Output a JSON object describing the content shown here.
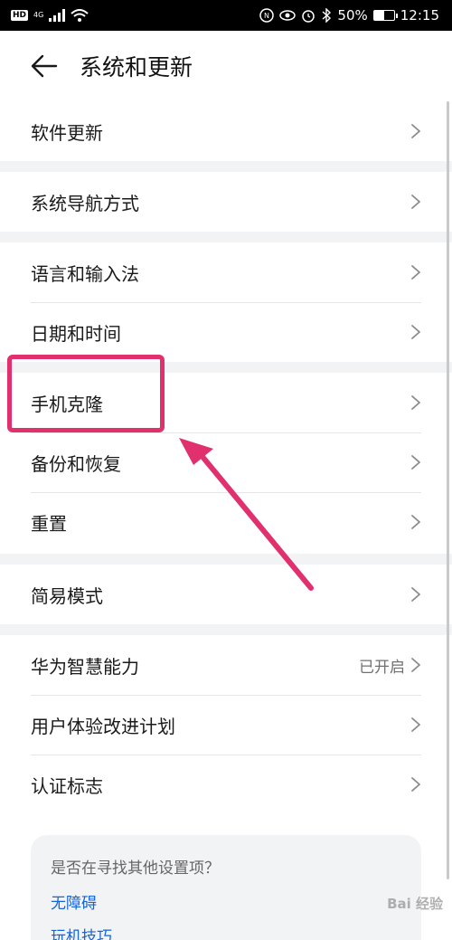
{
  "status_bar": {
    "hd": "HD",
    "network": "4G",
    "battery": "50%",
    "battery_level": 0.5,
    "time": "12:15",
    "icons": [
      "signal-icon",
      "wifi-icon",
      "nfc-icon",
      "eye-icon",
      "alarm-icon",
      "bluetooth-icon",
      "battery-icon"
    ]
  },
  "header": {
    "title": "系统和更新",
    "back_icon": "arrow-left-icon"
  },
  "groups": [
    {
      "items": [
        {
          "label": "软件更新"
        }
      ]
    },
    {
      "items": [
        {
          "label": "系统导航方式"
        }
      ]
    },
    {
      "items": [
        {
          "label": "语言和输入法"
        },
        {
          "label": "日期和时间"
        }
      ]
    },
    {
      "items": [
        {
          "label": "手机克隆"
        },
        {
          "label": "备份和恢复"
        },
        {
          "label": "重置"
        }
      ]
    },
    {
      "items": [
        {
          "label": "简易模式"
        }
      ]
    },
    {
      "items": [
        {
          "label": "华为智慧能力",
          "value": "已开启"
        },
        {
          "label": "用户体验改进计划"
        },
        {
          "label": "认证标志"
        }
      ]
    }
  ],
  "hint_card": {
    "question": "是否在寻找其他设置项？",
    "links": [
      "无障碍",
      "玩机技巧"
    ]
  },
  "annotation": {
    "color": "#e0306e",
    "highlighted_item": "手机克隆"
  },
  "watermark": "Bai 经验",
  "colors": {
    "accent": "#1565d8",
    "separator": "#f1f3f5",
    "annotation": "#e0306e"
  }
}
